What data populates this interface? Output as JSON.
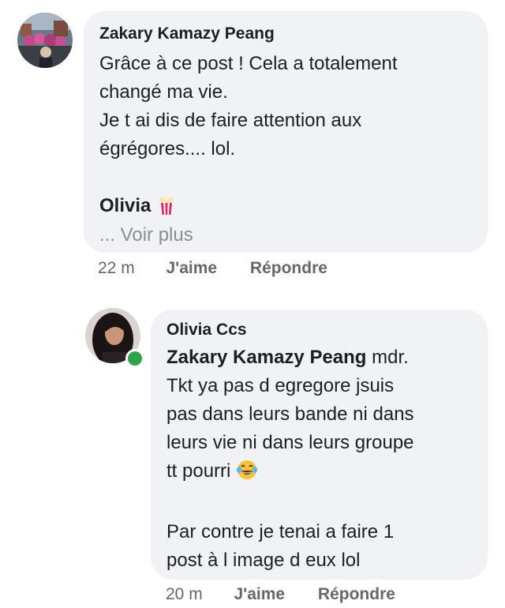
{
  "comment1": {
    "author": "Zakary Kamazy Peang",
    "lines": [
      "Grâce à ce post ! Cela a totalement",
      "changé ma vie.",
      "Je t ai dis de faire attention aux",
      "égrégores.... lol."
    ],
    "tag_name": "Olivia",
    "tag_emoji": "popcorn-icon",
    "see_more": "... Voir plus",
    "time": "22 m",
    "like": "J'aime",
    "reply": "Répondre"
  },
  "comment2": {
    "author": "Olivia Ccs",
    "mention": "Zakary Kamazy Peang",
    "first_line_rest": " mdr.",
    "lines": [
      "Tkt ya pas d egregore  jsuis",
      "pas dans leurs bande ni dans",
      "leurs vie ni dans leurs groupe",
      "tt pourri"
    ],
    "emoji": "laughing-tears-icon",
    "lines_after": [
      "Par contre je tenai a faire 1",
      "post à l image d eux lol"
    ],
    "time": "20 m",
    "like": "J'aime",
    "reply": "Répondre",
    "online": true
  },
  "colors": {
    "bubble": "#f0f2f5",
    "meta": "#65676b",
    "see_more": "#8a8d91",
    "online": "#31a24c"
  }
}
